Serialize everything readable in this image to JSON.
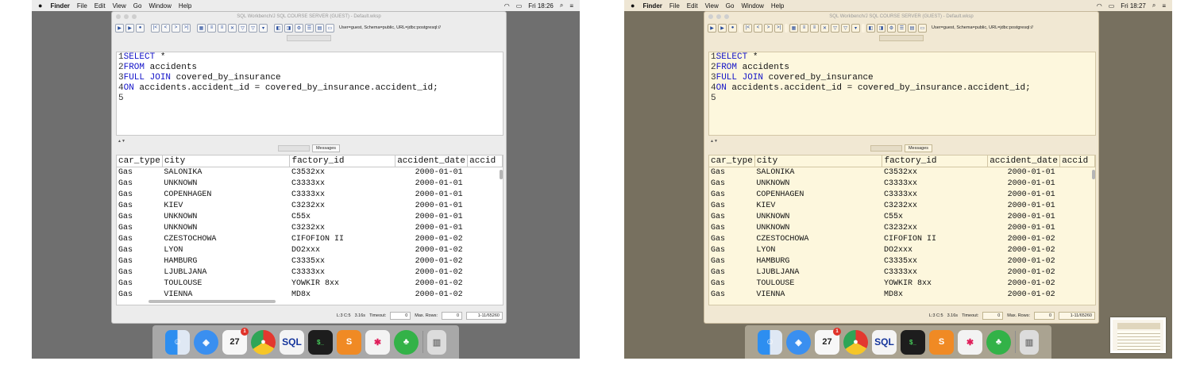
{
  "menubar": {
    "apple": "",
    "items": [
      "Finder",
      "File",
      "Edit",
      "View",
      "Go",
      "Window",
      "Help"
    ],
    "left_clock": "Fri 18:26",
    "right_clock": "Fri 18:27"
  },
  "window": {
    "title": "SQL Workbench/J SQL COURSE SERVER (GUEST) - Default.wksp",
    "connection": "User=guest, Schema=public, URL=jdbc:postgresql://"
  },
  "editor": {
    "lines": [
      {
        "num": "1",
        "kw": "SELECT",
        "rest": " *"
      },
      {
        "num": "2",
        "kw": "FROM",
        "rest": " accidents"
      },
      {
        "num": "3",
        "kw": "FULL JOIN",
        "rest": " covered_by_insurance"
      },
      {
        "num": "4",
        "kw": "ON",
        "rest": " accidents.accident_id = covered_by_insurance.accident_id;"
      },
      {
        "num": "5",
        "kw": "",
        "rest": ""
      }
    ]
  },
  "results": {
    "tab_label": "Messages",
    "columns": [
      "car_type",
      "city",
      "factory_id",
      "accident_date",
      "accid"
    ],
    "rows": [
      [
        "Gas",
        "SALONIKA",
        "C3532xx",
        "2000-01-01"
      ],
      [
        "Gas",
        "UNKNOWN",
        "C3333xx",
        "2000-01-01"
      ],
      [
        "Gas",
        "COPENHAGEN",
        "C3333xx",
        "2000-01-01"
      ],
      [
        "Gas",
        "KIEV",
        "C3232xx",
        "2000-01-01"
      ],
      [
        "Gas",
        "UNKNOWN",
        "C55x",
        "2000-01-01"
      ],
      [
        "Gas",
        "UNKNOWN",
        "C3232xx",
        "2000-01-01"
      ],
      [
        "Gas",
        "CZESTOCHOWA",
        "CIFOFION II",
        "2000-01-02"
      ],
      [
        "Gas",
        "LYON",
        "DO2xxx",
        "2000-01-02"
      ],
      [
        "Gas",
        "HAMBURG",
        "C3335xx",
        "2000-01-02"
      ],
      [
        "Gas",
        "LJUBLJANA",
        "C3333xx",
        "2000-01-02"
      ],
      [
        "Gas",
        "TOULOUSE",
        "YOWKIR 8xx",
        "2000-01-02"
      ],
      [
        "Gas",
        "VIENNA",
        "MD8x",
        "2000-01-02"
      ]
    ]
  },
  "status": {
    "cursor": "L:3 C:5",
    "time": "3.16s",
    "timeout_label": "Timeout:",
    "timeout_value": "0",
    "maxrows_label": "Max. Rows:",
    "maxrows_value": "0",
    "range": "1-11/65260"
  },
  "dock": {
    "calendar_month": "MAR",
    "calendar_day": "27",
    "calendar_badge": "1",
    "sql_label": "SQL",
    "terminal_label": "$_"
  },
  "colors": {
    "keyword": "#1212c8",
    "night_shift_tint": "#fdf7dd"
  }
}
